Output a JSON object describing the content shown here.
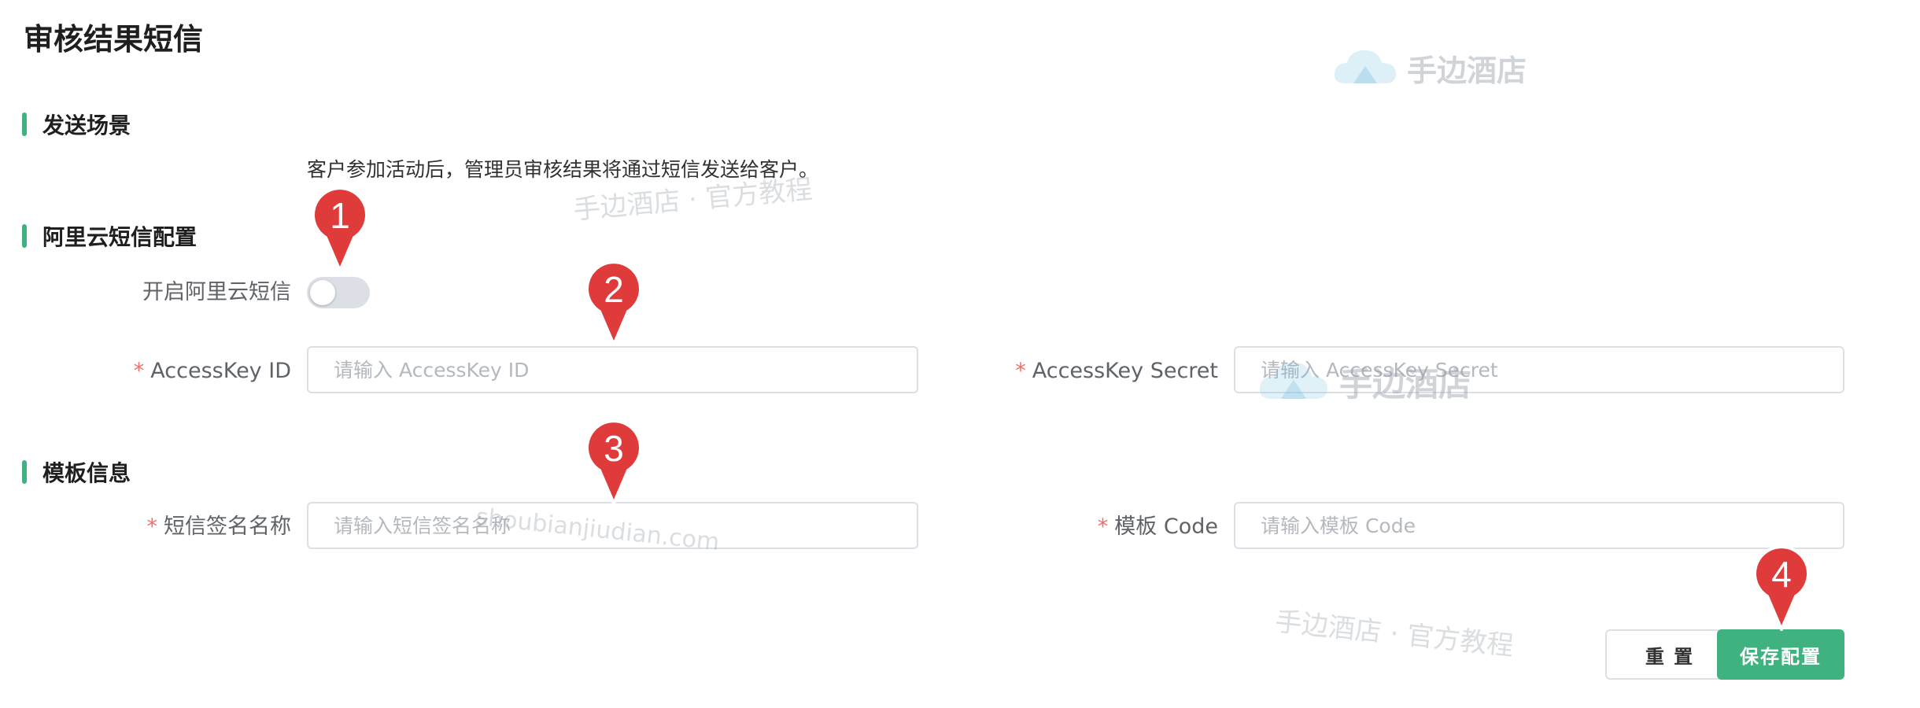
{
  "page_title": "审核结果短信",
  "sections": {
    "scene": {
      "title": "发送场景",
      "description": "客户参加活动后，管理员审核结果将通过短信发送给客户。"
    },
    "aliyun": {
      "title": "阿里云短信配置",
      "toggle_label": "开启阿里云短信",
      "toggle_on": false
    },
    "template": {
      "title": "模板信息"
    }
  },
  "fields": {
    "access_key_id": {
      "label": "AccessKey ID",
      "placeholder": "请输入 AccessKey ID",
      "value": ""
    },
    "access_key_secret": {
      "label": "AccessKey Secret",
      "placeholder": "请输入 AccessKey Secret",
      "value": ""
    },
    "sign_name": {
      "label": "短信签名名称",
      "placeholder": "请输入短信签名名称",
      "value": ""
    },
    "template_code": {
      "label": "模板 Code",
      "placeholder": "请输入模板 Code",
      "value": ""
    }
  },
  "required_mark": "*",
  "buttons": {
    "reset": "重 置",
    "save": "保存配置"
  },
  "markers": [
    "1",
    "2",
    "3",
    "4"
  ],
  "watermarks": {
    "logo_text": "手边酒店",
    "tagline": "手边酒店 · 官方教程",
    "domain": "shoubianjiudian.com"
  },
  "colors": {
    "accent": "#3fb27f",
    "marker": "#e03b3b",
    "required": "#f56c6c"
  }
}
